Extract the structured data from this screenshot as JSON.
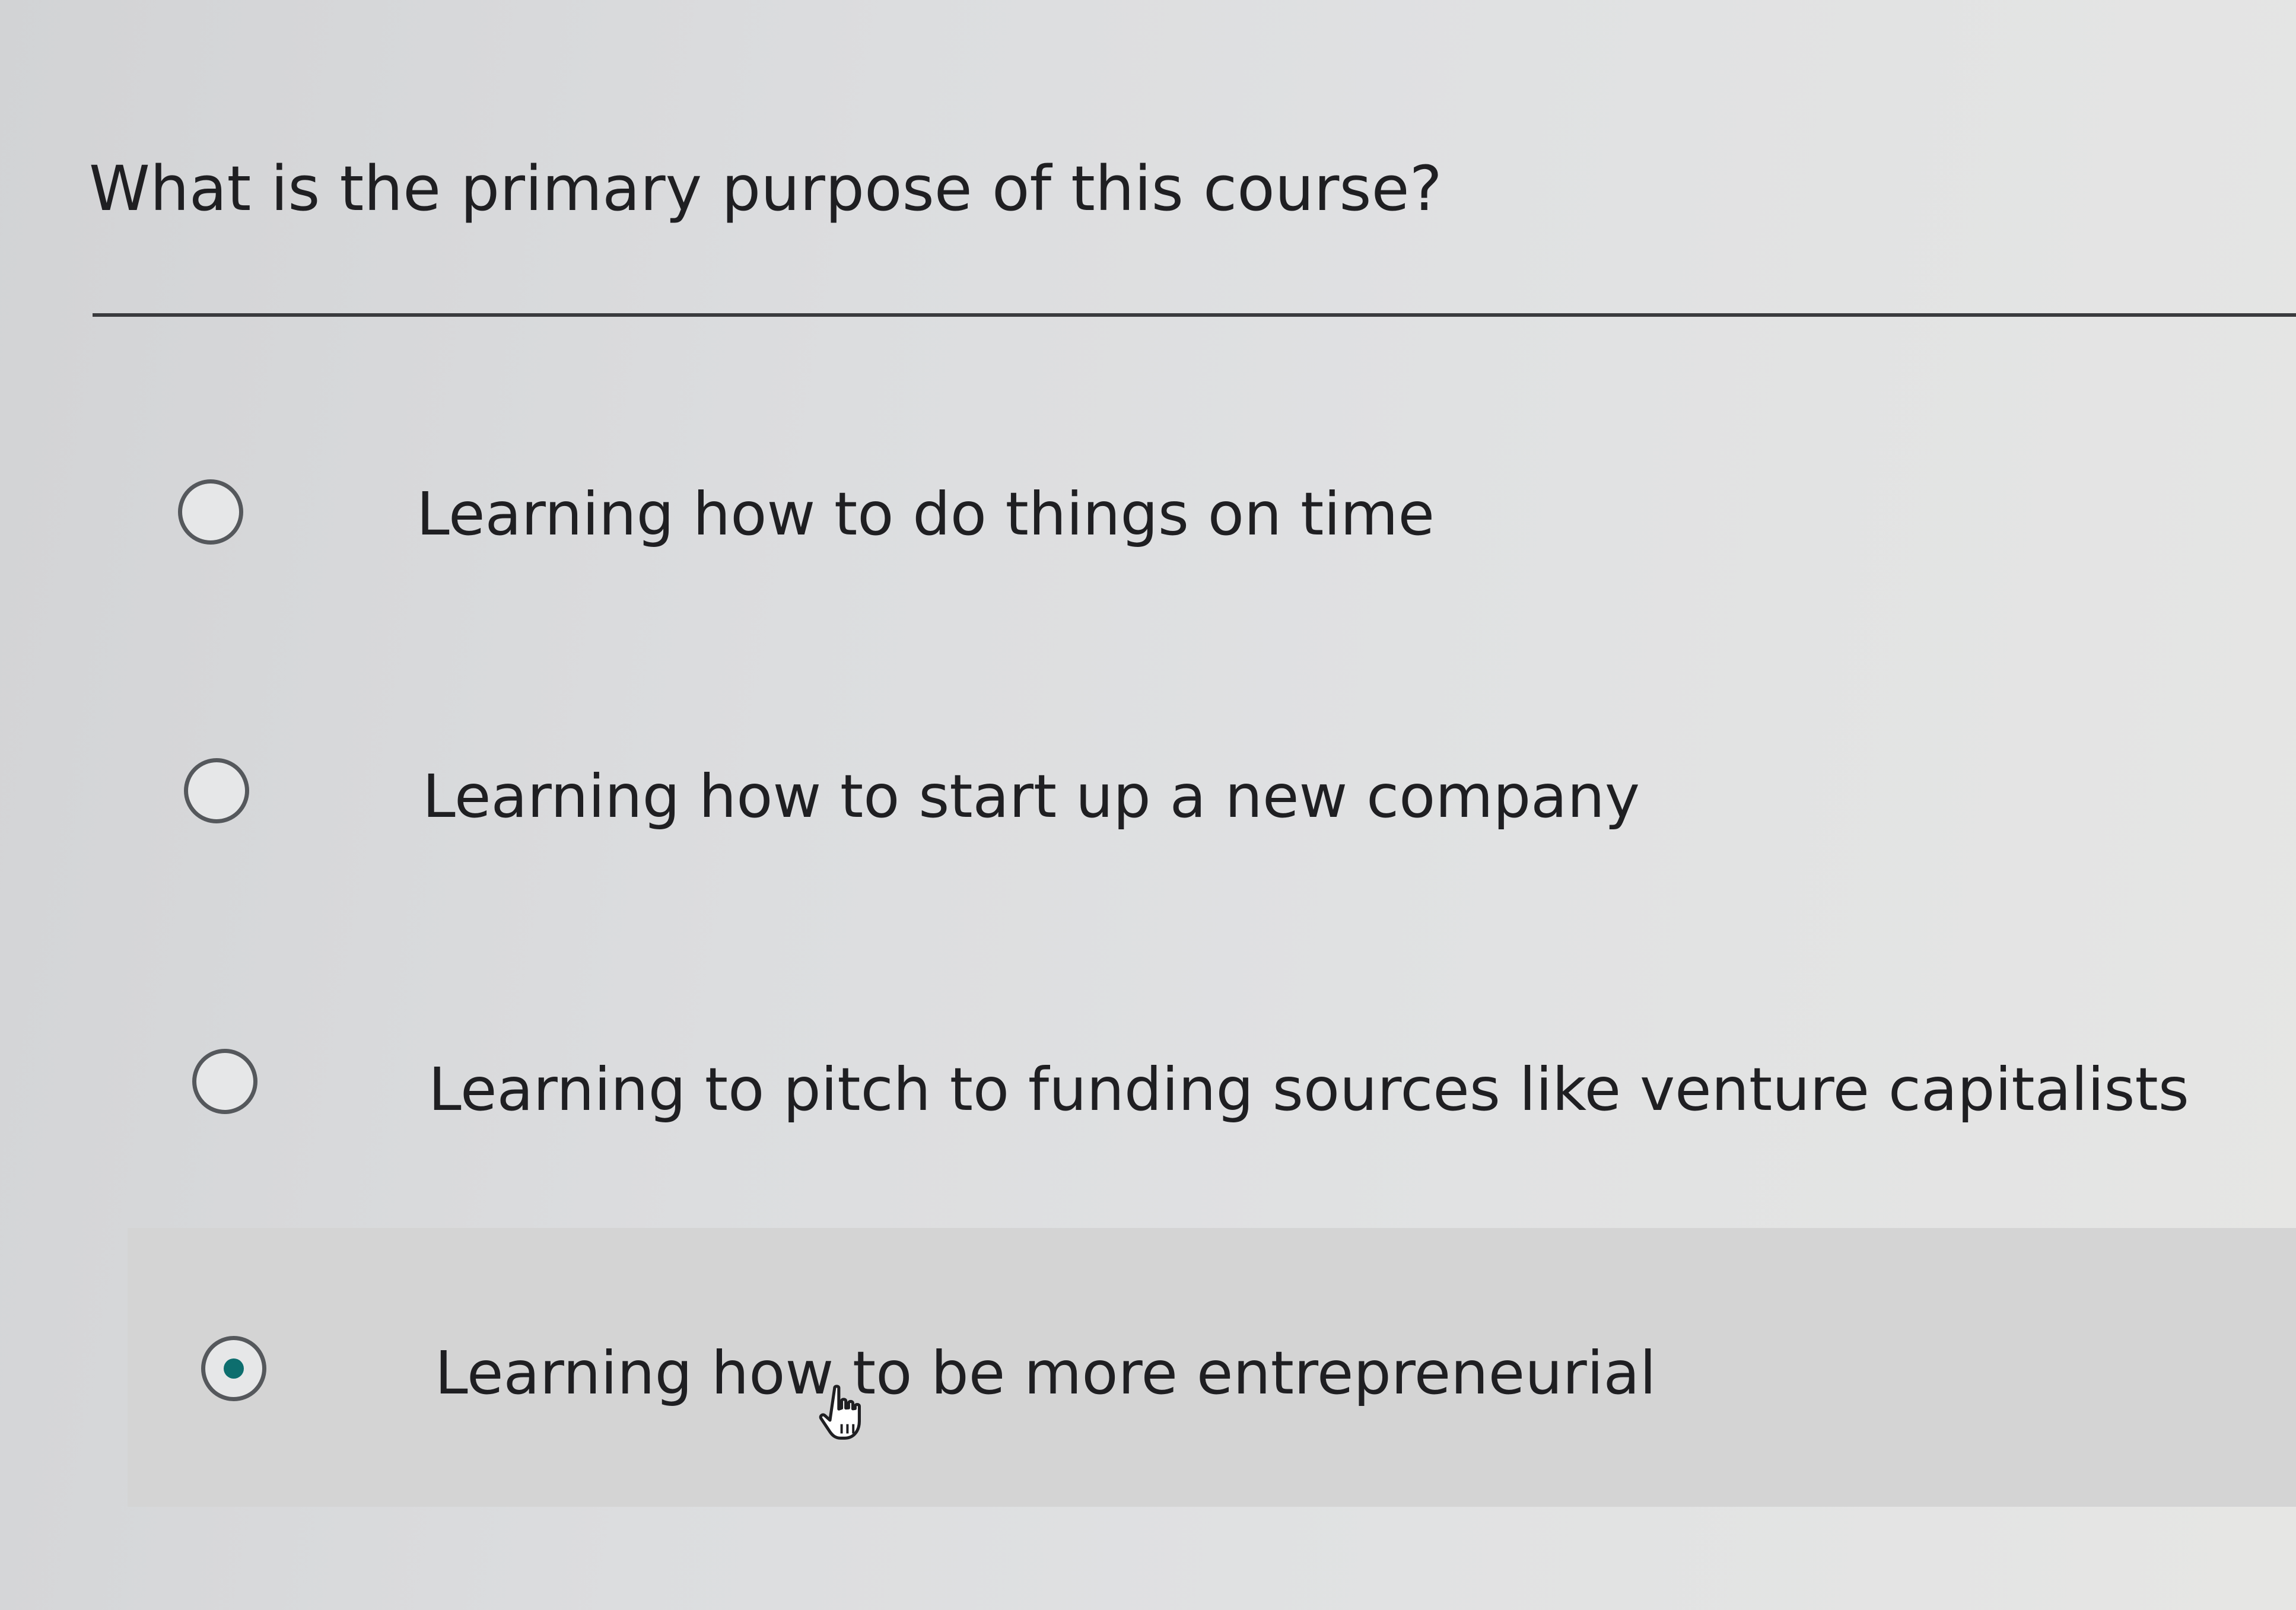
{
  "question": {
    "text": "What is the primary purpose of this course?"
  },
  "options": [
    {
      "label": "Learning how to do things on time",
      "selected": false
    },
    {
      "label": "Learning how to start up a new company",
      "selected": false
    },
    {
      "label": "Learning to pitch to funding sources like venture capitalists",
      "selected": false
    },
    {
      "label": "Learning how to be more entrepreneurial",
      "selected": true
    }
  ],
  "colors": {
    "radio_selected_dot": "#0d6e6e",
    "radio_border": "#55585c",
    "selected_row_background": "#d4d4d4"
  },
  "icons": {
    "cursor": "hand-pointer-icon"
  }
}
